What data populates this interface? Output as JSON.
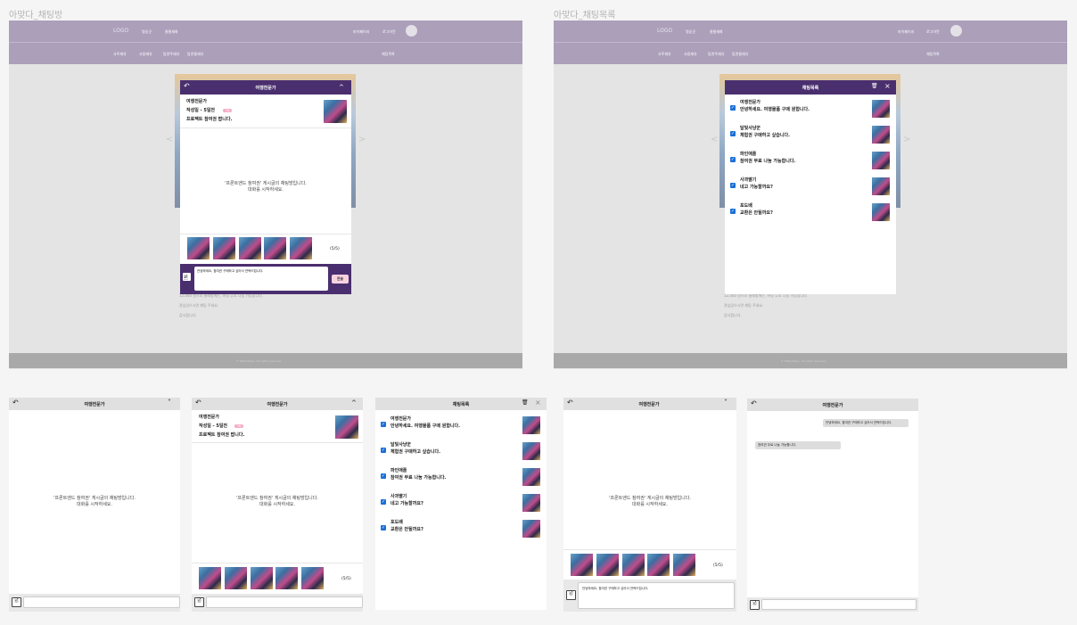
{
  "frames": {
    "left_title": "아맞다_채팅방",
    "right_title": "아맞다_채팅목록"
  },
  "site": {
    "logo": "LOGO",
    "nav_main": [
      "명승곳",
      "물물재화"
    ],
    "nav_right": [
      "마이페이지",
      "로그아웃"
    ],
    "sub_nav": [
      "사주재유",
      "사용재유",
      "탐관주재유",
      "탐관물재유"
    ],
    "sub_nav_right": "채팅목록",
    "footer": "© MatjoSteps. All rights reserved.",
    "arrow_left": "<",
    "arrow_right": ">",
    "bg_lines": [
      "12,000 원으로 물레방에는, 바닐 무료 나눔 가능합니다.",
      "관심있으시면 채팅 주세요.",
      "감사합니다."
    ]
  },
  "chat": {
    "title": "여행전문가",
    "back_icon": "↶",
    "collapse_icon": "^",
    "expand_icon": "˅",
    "post_author": "여행전문가",
    "post_meta": "작성일 - 5일전",
    "post_badge": "거래",
    "post_title": "프로젝트 참여권 팝니다.",
    "empty_msg_1": "'프론트엔드 참여권' 게시글의 채팅방입니다.",
    "empty_msg_2": "대화를 시작하세요.",
    "image_count": "(5/5)",
    "draft": "안녕하세요, 참여권 구매하고 싶어서 연락드립니다.",
    "send": "전송",
    "image_icon": "🖻"
  },
  "chat_list": {
    "title": "채팅목록",
    "trash_icon": "🗑",
    "close_icon": "×",
    "check_icon": "✓",
    "items": [
      {
        "name": "여행전문가",
        "msg": "안녕하세요. 여행물품 구매 원합니다."
      },
      {
        "name": "달빛사냥꾼",
        "msg": "체험권 구매하고 싶습니다."
      },
      {
        "name": "파인애플",
        "msg": "참여권 무료 나눔 가능합니다."
      },
      {
        "name": "사과딸기",
        "msg": "네고 가능할까요?"
      },
      {
        "name": "포도배",
        "msg": "교환은 안될까요?"
      }
    ]
  },
  "conversation": {
    "sent": "안녕하세요, 참여권 구매하고 싶어서 연락드립니다.",
    "received": "참여권 무료 나눔 가능합니다."
  },
  "colors": {
    "nav": "#ab9fba",
    "chat_header": "#4a2f6f",
    "check": "#1a6fd6",
    "badge": "#f5a8c5"
  }
}
